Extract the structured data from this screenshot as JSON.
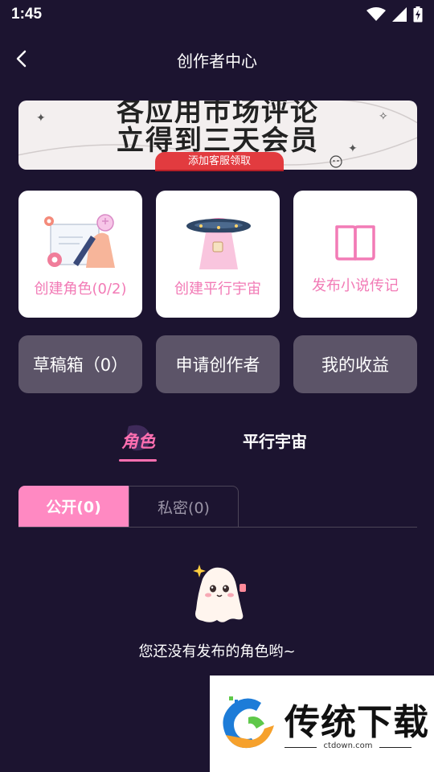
{
  "status": {
    "time": "1:45"
  },
  "header": {
    "title": "创作者中心"
  },
  "banner": {
    "line1": "各应用市场评论",
    "line2": "立得到三天会员",
    "button_label": "添加客服领取"
  },
  "cards": [
    {
      "label": "创建角色(0/2)"
    },
    {
      "label": "创建平行宇宙"
    },
    {
      "label": "发布小说传记"
    }
  ],
  "actions": [
    {
      "label": "草稿箱（0）"
    },
    {
      "label": "申请创作者"
    },
    {
      "label": "我的收益"
    }
  ],
  "tabs": {
    "role": "角色",
    "universe": "平行宇宙"
  },
  "segments": {
    "public": "公开(0)",
    "private": "私密(0)"
  },
  "empty_state": {
    "message": "您还没有发布的角色哟~"
  },
  "watermark": {
    "title": "传统下载",
    "site": "ctdown.com"
  },
  "colors": {
    "background": "#1c1430",
    "accent": "#ff89c2",
    "card_text": "#f27bb6",
    "gray_button": "#5c5468"
  }
}
